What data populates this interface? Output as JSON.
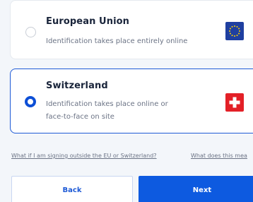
{
  "options": [
    {
      "title": "European Union",
      "description": "Identification takes place entirely online",
      "selected": false,
      "flag": "eu-flag-icon"
    },
    {
      "title": "Switzerland",
      "description": "Identification takes place online or face-to-face on site",
      "selected": true,
      "flag": "swiss-flag-icon"
    }
  ],
  "links": {
    "outside": "What if I am signing outside the EU or Switzerland?",
    "meaning": "What does this mea"
  },
  "buttons": {
    "back": "Back",
    "next": "Next"
  },
  "colors": {
    "accent": "#0d5ae0",
    "selected_border": "#1e5ad6",
    "eu_flag": "#1f3fa0",
    "swiss_flag": "#e32027"
  }
}
